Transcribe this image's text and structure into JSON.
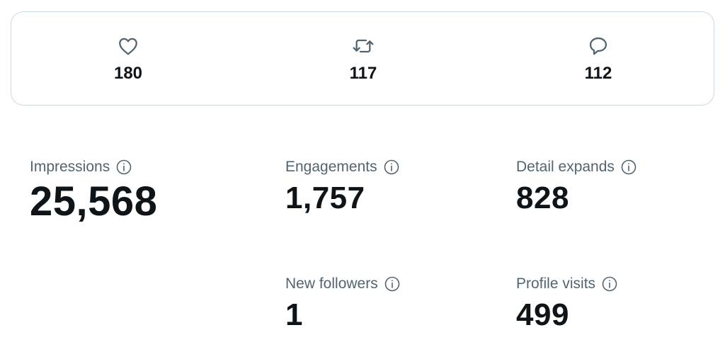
{
  "engagements_bar": {
    "likes": {
      "icon": "heart-icon",
      "count": "180"
    },
    "reposts": {
      "icon": "repost-icon",
      "count": "117"
    },
    "replies": {
      "icon": "reply-icon",
      "count": "112"
    }
  },
  "metrics": {
    "impressions": {
      "label": "Impressions",
      "value": "25,568",
      "icon": "info-icon"
    },
    "engagements": {
      "label": "Engagements",
      "value": "1,757",
      "icon": "info-icon"
    },
    "detail_expands": {
      "label": "Detail expands",
      "value": "828",
      "icon": "info-icon"
    },
    "new_followers": {
      "label": "New followers",
      "value": "1",
      "icon": "info-icon"
    },
    "profile_visits": {
      "label": "Profile visits",
      "value": "499",
      "icon": "info-icon"
    }
  },
  "colors": {
    "text_primary": "#0f1419",
    "text_secondary": "#536471",
    "border": "#cfd9de",
    "background": "#ffffff"
  }
}
